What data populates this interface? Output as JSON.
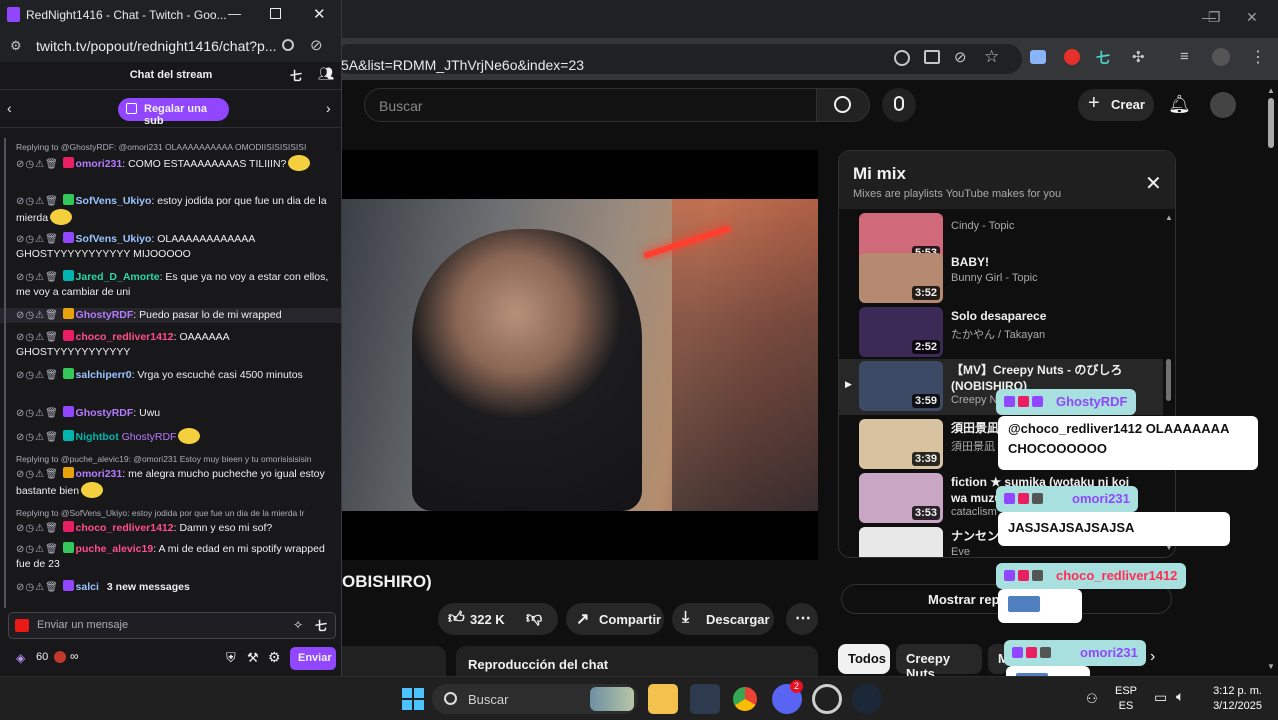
{
  "popup": {
    "window_title": "RedNight1416 - Chat - Twitch - Goo...",
    "address": "twitch.tv/popout/rednight1416/chat?p...",
    "chat_header": "Chat del stream",
    "gift_button": "Regalar una sub",
    "input_placeholder": "Enviar un mensaje",
    "points": "60",
    "send_button": "Enviar",
    "new_messages": "3 new messages",
    "messages": [
      {
        "reply": "Replying to @GhostyRDF: @omori231 OLAAAAAAAAAA OMODIISISISISISI",
        "user": "omori231",
        "color": "#b57bff",
        "text": ": COMO ESTAAAAAAAAS TILIIIN?"
      },
      {
        "user": "SofVens_Ukiyo",
        "color": "#9bc3ff",
        "text": ": estoy jodida por que fue un dia de la mierda"
      },
      {
        "user": "SofVens_Ukiyo",
        "color": "#9bc3ff",
        "text": ": OLAAAAAAAAAAAA GHOSTYYYYYYYYYYY MIJOOOOO"
      },
      {
        "user": "Jared_D_Amorte",
        "color": "#2ad6a3",
        "text": ": Es que ya no voy a estar con ellos, me voy a cambiar de uni"
      },
      {
        "user": "GhostyRDF",
        "color": "#b57bff",
        "text": ": Puedo pasar lo de mi wrapped"
      },
      {
        "user": "choco_redliver1412",
        "color": "#ff4f87",
        "text": ": OAAAAAA GHOSTYYYYYYYYYYY"
      },
      {
        "user": "salchiperr0",
        "color": "#9bc3ff",
        "text": ": Vrga yo escuché casi 4500 minutos"
      },
      {
        "user": "GhostyRDF",
        "color": "#b57bff",
        "text": ": Uwu"
      },
      {
        "user": "Nightbot",
        "color": "#00b5ad",
        "text": " GhostyRDF"
      },
      {
        "reply": "Replying to @puche_alevic19: @omori231 Estoy muy bieen y tu omorisisisisin",
        "user": "omori231",
        "color": "#b57bff",
        "text": ": me alegra mucho pucheche yo igual estoy bastante bien"
      },
      {
        "reply": "Replying to @SofVens_Ukiyo: estoy jodida por que fue un dia de la mierda lr",
        "user": "choco_redliver1412",
        "color": "#ff4f87",
        "text": ": Damn y eso mi sof?"
      },
      {
        "user": "puche_alevic19",
        "color": "#ff4f87",
        "text": ": A mi de edad en mi spotify wrapped fue de 23"
      },
      {
        "user": "salci",
        "color": "#9bc3ff",
        "text": ""
      }
    ]
  },
  "browser": {
    "address": "c5A&list=RDMM_JThVrjNe6o&index=23"
  },
  "youtube": {
    "search_placeholder": "Buscar",
    "create_button": "Crear",
    "video_title": "OBISHIRO)",
    "likes": "322 K",
    "share_button": "Compartir",
    "download_button": "Descargar",
    "chat_replay": "Reproducción del chat",
    "mix": {
      "title": "Mi mix",
      "subtitle": "Mixes are playlists YouTube makes for you",
      "items": [
        {
          "title": "",
          "artist": "Cindy - Topic",
          "duration": "5:53",
          "thumb": "#d06a7a"
        },
        {
          "title": "BABY!",
          "artist": "Bunny Girl - Topic",
          "duration": "3:52",
          "thumb": "#b58a70"
        },
        {
          "title": "Solo desaparece",
          "artist": "たかやん / Takayan",
          "duration": "2:52",
          "thumb": "#3a2a55"
        },
        {
          "title": "【MV】Creepy Nuts - のびしろ (NOBISHIRO)",
          "artist": "Creepy N",
          "duration": "3:59",
          "thumb": "#3c4a66"
        },
        {
          "title": "須田景凪",
          "artist": "須田景凪 -",
          "duration": "3:39",
          "thumb": "#d8c3a0"
        },
        {
          "title": "fiction ★ sumika (wotaku ni koi wa muzu",
          "artist": "cataclism",
          "duration": "3:53",
          "thumb": "#c9a6c4"
        },
        {
          "title": "ナンセン",
          "artist": "Eve",
          "duration": "",
          "thumb": "#e8e8e8"
        }
      ],
      "show_more": "Mostrar repro"
    },
    "chips": [
      "Todos",
      "Creepy Nuts",
      "M"
    ]
  },
  "overlay": [
    {
      "name": "GhostyRDF",
      "name_color": "#9147ff",
      "message": "@choco_redliver1412 OLAAAAAAA CHOCOOOOOO"
    },
    {
      "name": "omori231",
      "name_color": "#9147ff",
      "message": "JASJSAJSAJSAJSA"
    },
    {
      "name": "choco_redliver1412",
      "name_color": "#ff2d55",
      "message": ""
    },
    {
      "name": "omori231",
      "name_color": "#9147ff",
      "message": ""
    }
  ],
  "taskbar": {
    "search": "Buscar",
    "lang1": "ESP",
    "lang2": "ES",
    "time": "3:12 p. m.",
    "date": "3/12/2025",
    "badge": "2"
  }
}
